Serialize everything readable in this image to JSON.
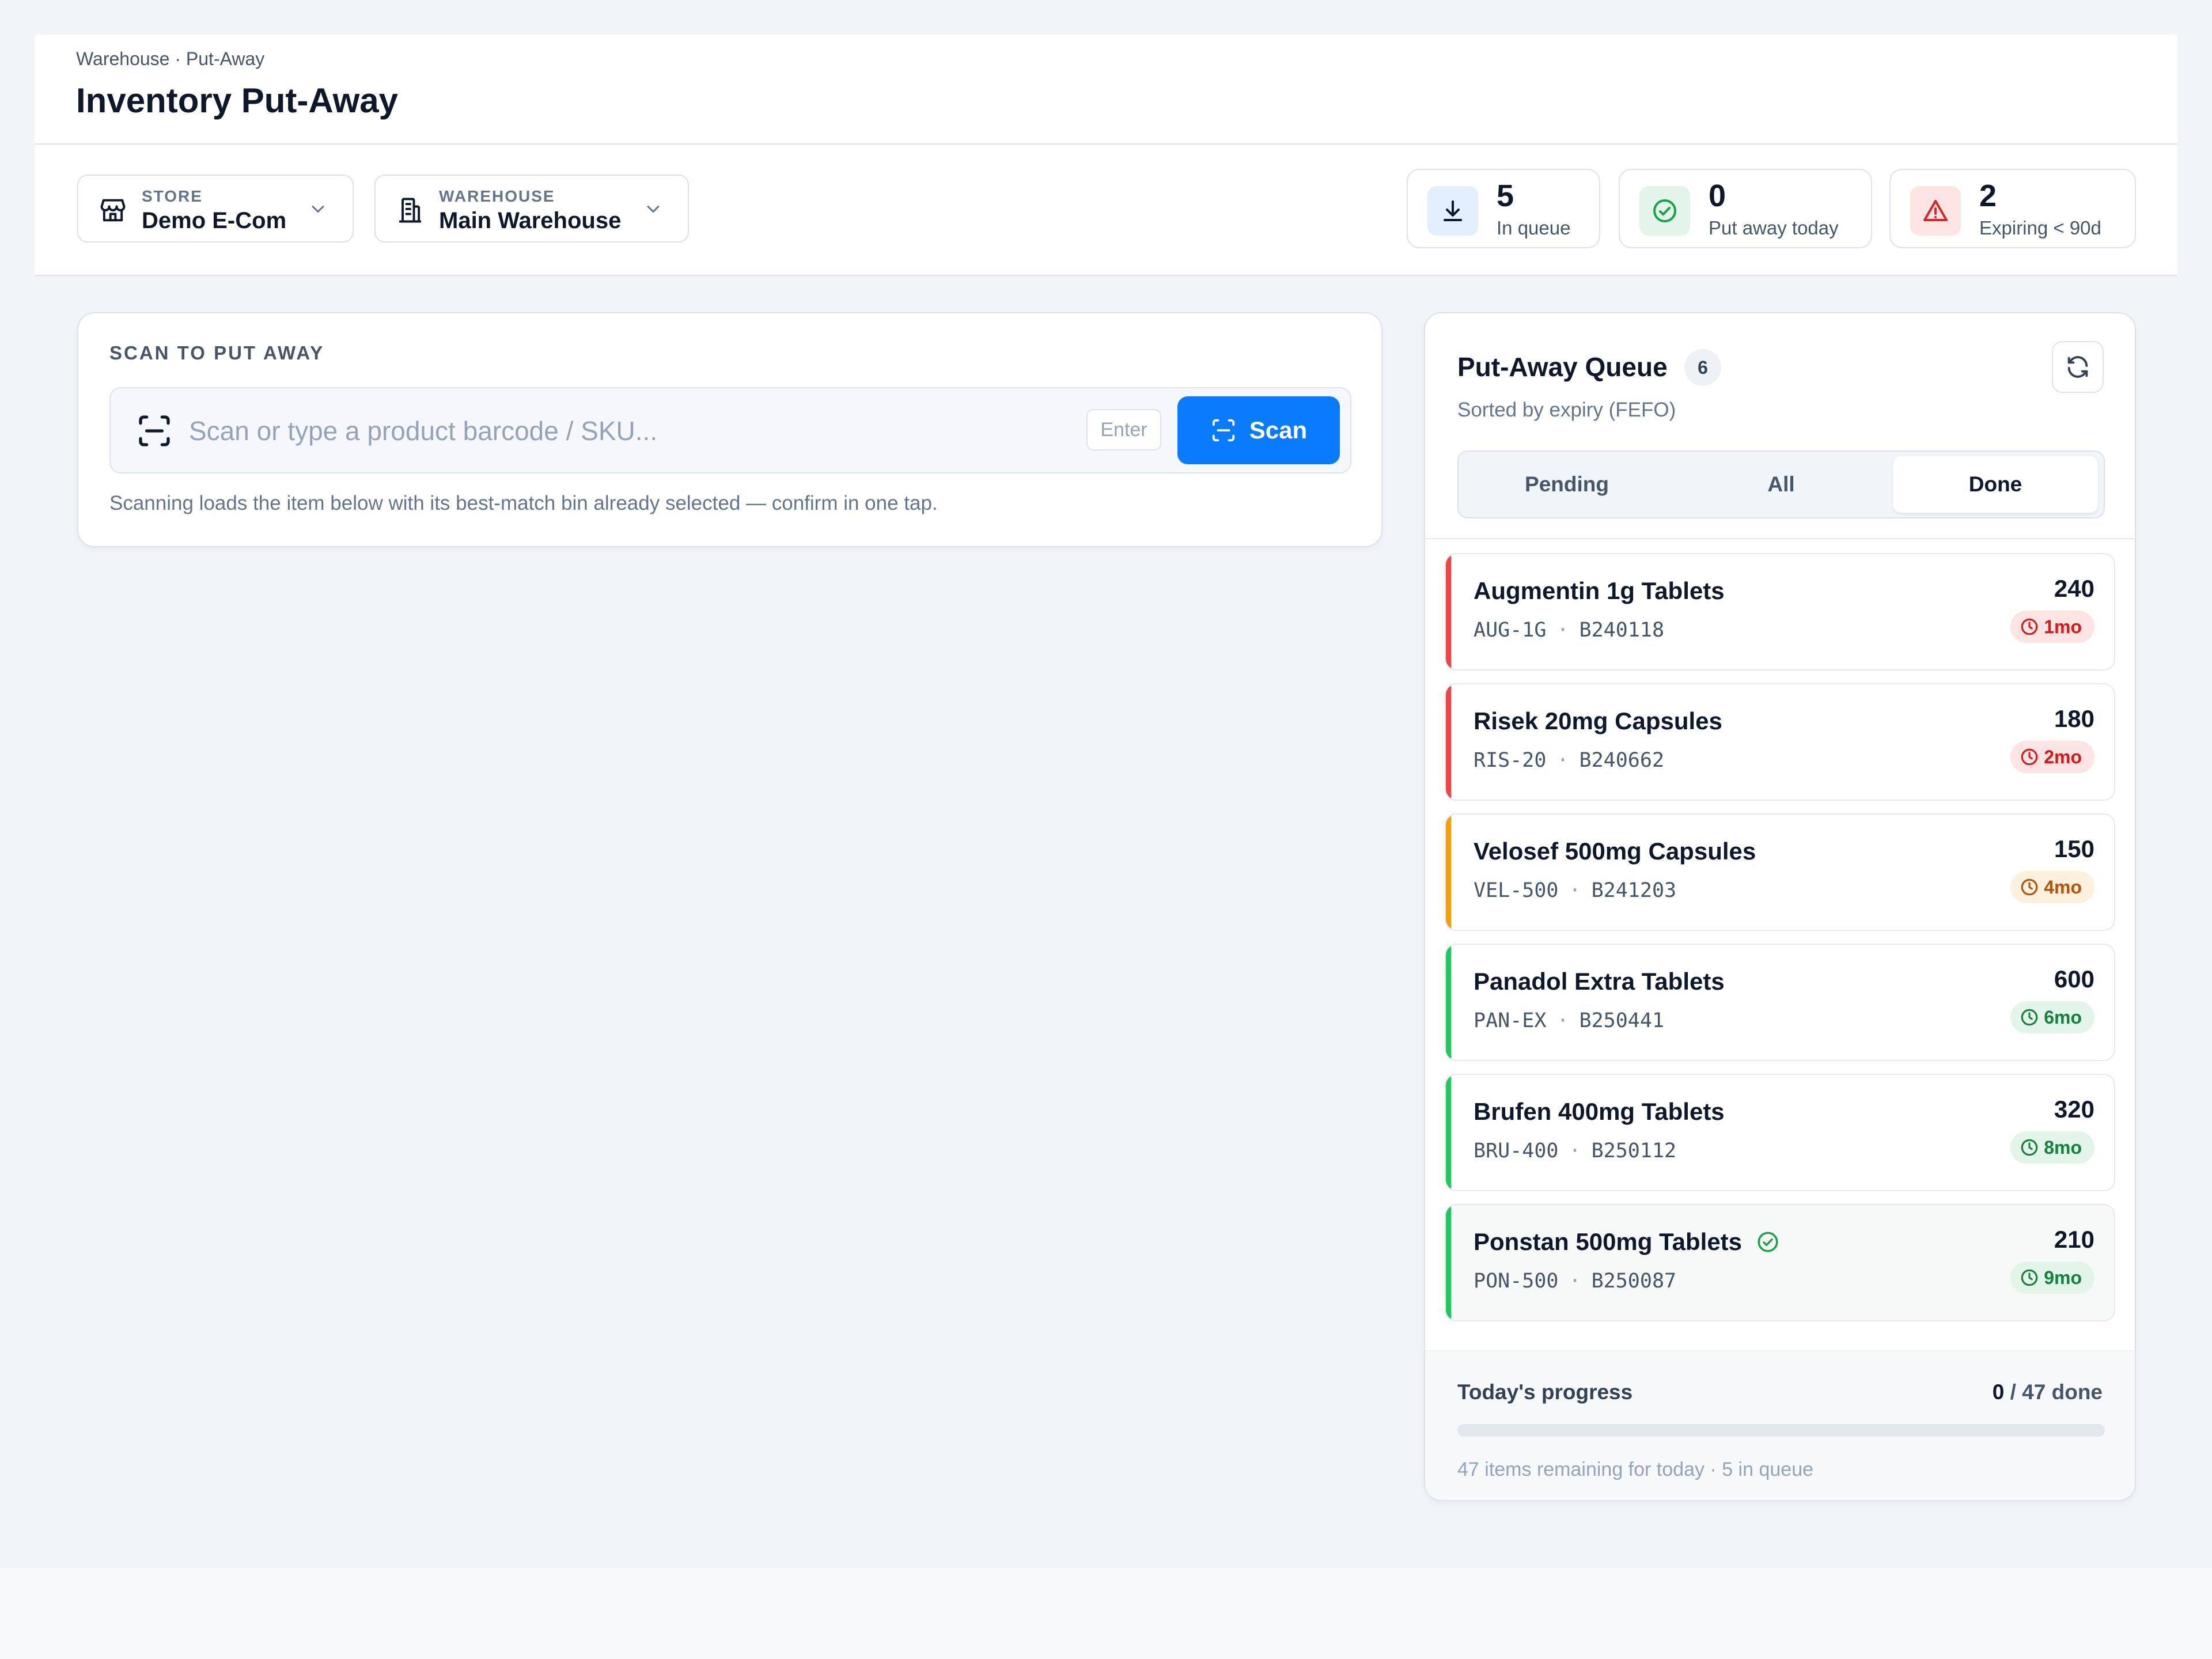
{
  "header": {
    "breadcrumb": "Warehouse · Put-Away",
    "title": "Inventory Put-Away"
  },
  "filters": {
    "store": {
      "label": "STORE",
      "value": "Demo E-Com",
      "icon": "store-icon"
    },
    "warehouse": {
      "label": "WAREHOUSE",
      "value": "Main Warehouse",
      "icon": "building-icon"
    }
  },
  "stats": {
    "in_queue": {
      "value": "5",
      "label": "In queue",
      "icon": "download-icon",
      "color": "#2563eb"
    },
    "put_away_today": {
      "value": "0",
      "label": "Put away today",
      "icon": "check-circle-icon",
      "color": "#16a34a"
    },
    "expiring": {
      "value": "2",
      "label": "Expiring < 90d",
      "icon": "warning-icon",
      "color": "#dc2626"
    }
  },
  "scan": {
    "title": "SCAN TO PUT AWAY",
    "placeholder": "Scan or type a product barcode / SKU...",
    "value": "",
    "enter_key": "Enter",
    "button_label": "Scan",
    "hint": "Scanning loads the item below with its best-match bin already selected — confirm in one tap.",
    "accent": "#0a7aff"
  },
  "queue": {
    "title": "Put-Away Queue",
    "count": "6",
    "subtitle": "Sorted by expiry (FEFO)",
    "tabs": [
      {
        "label": "Pending",
        "active": false
      },
      {
        "label": "All",
        "active": false
      },
      {
        "label": "Done",
        "active": true
      }
    ],
    "items": [
      {
        "name": "Augmentin 1g Tablets",
        "sku": "AUG-1G",
        "batch": "B240118",
        "qty": "240",
        "expiry": "1mo",
        "status": "red",
        "done": false
      },
      {
        "name": "Risek 20mg Capsules",
        "sku": "RIS-20",
        "batch": "B240662",
        "qty": "180",
        "expiry": "2mo",
        "status": "red",
        "done": false
      },
      {
        "name": "Velosef 500mg Capsules",
        "sku": "VEL-500",
        "batch": "B241203",
        "qty": "150",
        "expiry": "4mo",
        "status": "amber",
        "done": false
      },
      {
        "name": "Panadol Extra Tablets",
        "sku": "PAN-EX",
        "batch": "B250441",
        "qty": "600",
        "expiry": "6mo",
        "status": "green",
        "done": false
      },
      {
        "name": "Brufen 400mg Tablets",
        "sku": "BRU-400",
        "batch": "B250112",
        "qty": "320",
        "expiry": "8mo",
        "status": "green",
        "done": false
      },
      {
        "name": "Ponstan 500mg Tablets",
        "sku": "PON-500",
        "batch": "B250087",
        "qty": "210",
        "expiry": "9mo",
        "status": "green",
        "done": true
      }
    ],
    "status_colors": {
      "red": "#ef4444",
      "amber": "#f59e0b",
      "green": "#22c55e"
    }
  },
  "progress": {
    "label": "Today's progress",
    "done": "0",
    "total_text": " / 47 done",
    "fraction": 0,
    "note": "47 items remaining for today · 5 in queue"
  }
}
